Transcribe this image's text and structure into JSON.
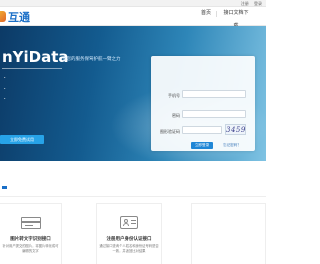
{
  "topbar": {
    "links": [
      "注册",
      "登录"
    ]
  },
  "header": {
    "logo_text": "互通",
    "nav": {
      "home": "首页",
      "docs": "接口文档下载"
    }
  },
  "banner": {
    "title": "nYiData",
    "slogan": "为您的服务保驾护航一臂之力",
    "features": [
      "·",
      "·",
      "·"
    ],
    "free_button": "立即免费试用"
  },
  "login": {
    "username_label": "手机号",
    "password_label": "密码",
    "code_label": "图形验证码",
    "captcha_text": "3459",
    "login_button": "立即登录",
    "forgot_link": "忘记密码？"
  },
  "cards": [
    {
      "title": "图片转文字识别接口",
      "desc": "针对用户提交的图片，将图片转化成可编辑的文字"
    },
    {
      "title": "注册用户身份认证接口",
      "desc": "通过接口查询个人姓名和身份证号码是否一致，并返回比对结果"
    },
    {
      "title": "",
      "desc": ""
    }
  ],
  "colors": {
    "brand": "#1a6fc7",
    "accent": "#27a3e8",
    "banner_dark": "#0c3a66"
  }
}
